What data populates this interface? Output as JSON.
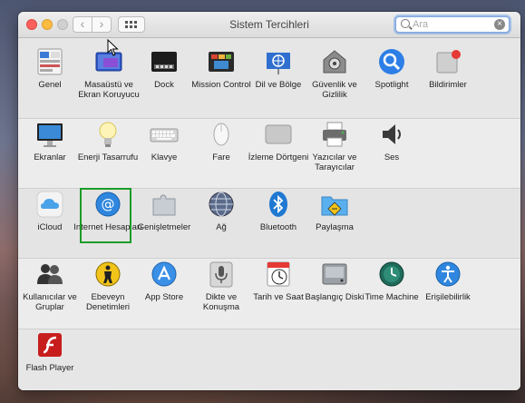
{
  "window": {
    "title": "Sistem Tercihleri",
    "search": {
      "placeholder": "Ara",
      "value": ""
    }
  },
  "titlebar": {
    "back_glyph": "‹",
    "forward_glyph": "›",
    "clear_glyph": "×"
  },
  "sections": [
    {
      "items": [
        {
          "name": "Genel",
          "icon": "general-icon"
        },
        {
          "name": "Masaüstü ve Ekran Koruyucu",
          "icon": "desktop-screensaver-icon"
        },
        {
          "name": "Dock",
          "icon": "dock-icon"
        },
        {
          "name": "Mission Control",
          "icon": "mission-control-icon"
        },
        {
          "name": "Dil ve Bölge",
          "icon": "language-region-icon"
        },
        {
          "name": "Güvenlik ve Gizlilik",
          "icon": "security-privacy-icon"
        },
        {
          "name": "Spotlight",
          "icon": "spotlight-icon"
        },
        {
          "name": "Bildirimler",
          "icon": "notifications-icon"
        }
      ]
    },
    {
      "items": [
        {
          "name": "Ekranlar",
          "icon": "displays-icon"
        },
        {
          "name": "Enerji Tasarrufu",
          "icon": "energy-saver-icon"
        },
        {
          "name": "Klavye",
          "icon": "keyboard-icon"
        },
        {
          "name": "Fare",
          "icon": "mouse-icon"
        },
        {
          "name": "İzleme Dörtgeni",
          "icon": "trackpad-icon"
        },
        {
          "name": "Yazıcılar ve Tarayıcılar",
          "icon": "printers-scanners-icon"
        },
        {
          "name": "Ses",
          "icon": "sound-icon"
        }
      ]
    },
    {
      "items": [
        {
          "name": "iCloud",
          "icon": "icloud-icon"
        },
        {
          "name": "Internet Hesapları",
          "icon": "internet-accounts-icon"
        },
        {
          "name": "Genişletmeler",
          "icon": "extensions-icon"
        },
        {
          "name": "Ağ",
          "icon": "network-icon"
        },
        {
          "name": "Bluetooth",
          "icon": "bluetooth-icon"
        },
        {
          "name": "Paylaşma",
          "icon": "sharing-icon"
        }
      ]
    },
    {
      "items": [
        {
          "name": "Kullanıcılar ve Gruplar",
          "icon": "users-groups-icon"
        },
        {
          "name": "Ebeveyn Denetimleri",
          "icon": "parental-controls-icon"
        },
        {
          "name": "App Store",
          "icon": "app-store-icon"
        },
        {
          "name": "Dikte ve Konuşma",
          "icon": "dictation-speech-icon"
        },
        {
          "name": "Tarih ve Saat",
          "icon": "date-time-icon"
        },
        {
          "name": "Başlangıç Diski",
          "icon": "startup-disk-icon"
        },
        {
          "name": "Time Machine",
          "icon": "time-machine-icon"
        },
        {
          "name": "Erişilebilirlik",
          "icon": "accessibility-icon"
        }
      ]
    },
    {
      "items": [
        {
          "name": "Flash Player",
          "icon": "flash-player-icon"
        }
      ]
    }
  ],
  "selected_item": "Internet Hesapları",
  "colors": {
    "selection_outline": "#1b9c27",
    "search_focus": "#7da4dc"
  }
}
